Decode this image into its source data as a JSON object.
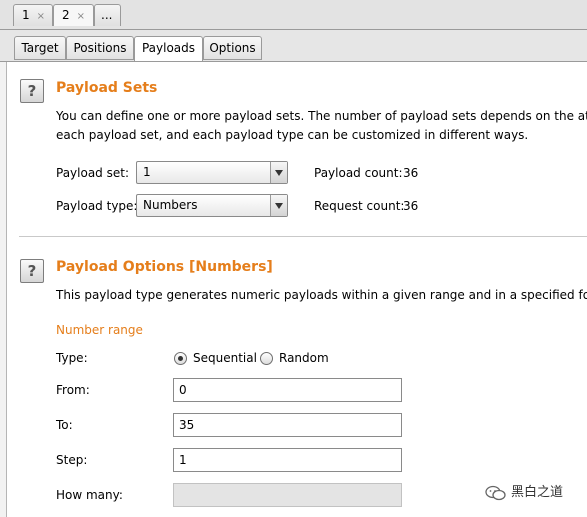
{
  "top_tabs": [
    {
      "label": "1",
      "close": "×"
    },
    {
      "label": "2",
      "close": "×"
    },
    {
      "label": "..."
    }
  ],
  "sub_tabs": [
    "Target",
    "Positions",
    "Payloads",
    "Options"
  ],
  "active_sub_tab": "Payloads",
  "payload_sets": {
    "title": "Payload Sets",
    "desc_line1": "You can define one or more payload sets. The number of payload sets depends on the attack type",
    "desc_line2": "each payload set, and each payload type can be customized in different ways.",
    "set_label": "Payload set:",
    "set_value": "1",
    "type_label": "Payload type:",
    "type_value": "Numbers",
    "count_label": "Payload count:",
    "count_value": "36",
    "request_label": "Request count:",
    "request_value": "36"
  },
  "payload_options": {
    "title": "Payload Options [Numbers]",
    "desc": "This payload type generates numeric payloads within a given range and in a specified format.",
    "range_heading": "Number range",
    "type_label": "Type:",
    "opt_sequential": "Sequential",
    "opt_random": "Random",
    "selected": "Sequential",
    "from_label": "From:",
    "from_value": "0",
    "to_label": "To:",
    "to_value": "35",
    "step_label": "Step:",
    "step_value": "1",
    "howmany_label": "How many:",
    "howmany_value": ""
  },
  "help_glyph": "?",
  "icons": {
    "help": "question-icon",
    "dropdown": "chevron-down-icon",
    "close": "close-icon",
    "watermark": "wechat-icon"
  },
  "colors": {
    "accent": "#e57e1b"
  },
  "watermark": "黑白之道"
}
